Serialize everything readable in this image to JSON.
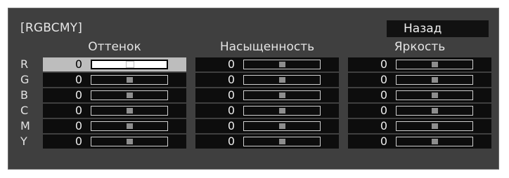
{
  "menu": {
    "title": "[RGBCMY]",
    "back_label": "Назад"
  },
  "columns": [
    {
      "key": "hue",
      "label": "Оттенок"
    },
    {
      "key": "saturation",
      "label": "Насыщенность"
    },
    {
      "key": "brightness",
      "label": "Яркость"
    }
  ],
  "rows": [
    {
      "label": "R",
      "values": {
        "hue": "0",
        "saturation": "0",
        "brightness": "0"
      },
      "slider_level": {
        "hue": 0.5,
        "saturation": 0.5,
        "brightness": 0.5
      }
    },
    {
      "label": "G",
      "values": {
        "hue": "0",
        "saturation": "0",
        "brightness": "0"
      },
      "slider_level": {
        "hue": 0.5,
        "saturation": 0.5,
        "brightness": 0.5
      }
    },
    {
      "label": "B",
      "values": {
        "hue": "0",
        "saturation": "0",
        "brightness": "0"
      },
      "slider_level": {
        "hue": 0.5,
        "saturation": 0.5,
        "brightness": 0.5
      }
    },
    {
      "label": "C",
      "values": {
        "hue": "0",
        "saturation": "0",
        "brightness": "0"
      },
      "slider_level": {
        "hue": 0.5,
        "saturation": 0.5,
        "brightness": 0.5
      }
    },
    {
      "label": "M",
      "values": {
        "hue": "0",
        "saturation": "0",
        "brightness": "0"
      },
      "slider_level": {
        "hue": 0.5,
        "saturation": 0.5,
        "brightness": 0.5
      }
    },
    {
      "label": "Y",
      "values": {
        "hue": "0",
        "saturation": "0",
        "brightness": "0"
      },
      "slider_level": {
        "hue": 0.5,
        "saturation": 0.5,
        "brightness": 0.5
      }
    }
  ],
  "selected": {
    "row": "R",
    "column": "hue"
  },
  "colors": {
    "panel_background": "#3f3f3f",
    "cell_background": "#0d0d0d",
    "selected_background": "#bdbdbd",
    "text": "#e6e6e6"
  },
  "icons": {
    "slider_thumb": "square-thumb-icon"
  }
}
